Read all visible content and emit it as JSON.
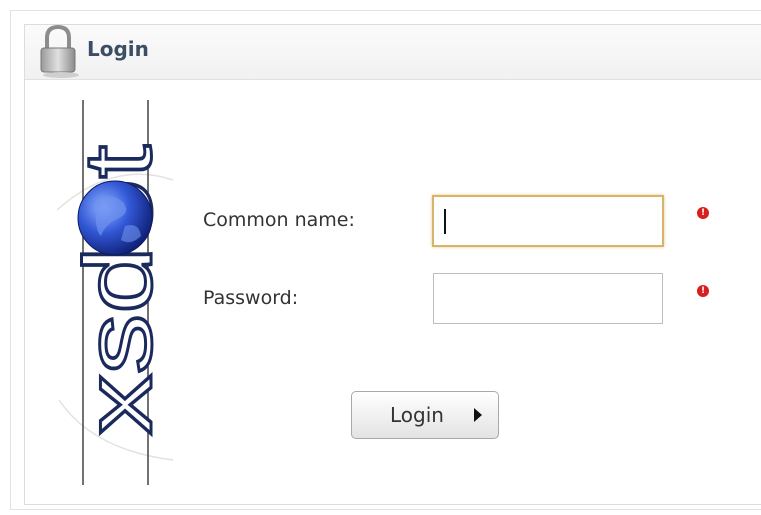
{
  "header": {
    "title": "Login",
    "icon": "lock-icon"
  },
  "logo": {
    "text": "xsdot"
  },
  "form": {
    "common_name_label": "Common name:",
    "common_name_value": "",
    "password_label": "Password:",
    "password_value": "",
    "required_marker": "!"
  },
  "buttons": {
    "login_label": "Login",
    "login_icon": "arrow-right-icon"
  },
  "colors": {
    "title": "#3b4e66",
    "focused_border": "#d7b46a",
    "required": "#d81f1f"
  }
}
